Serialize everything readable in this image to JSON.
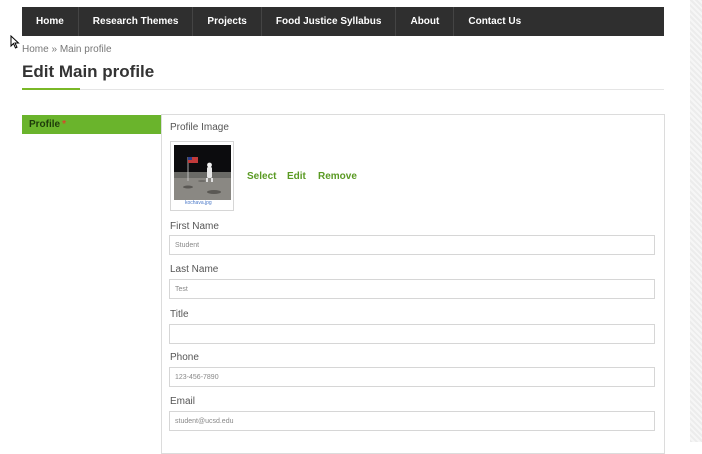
{
  "nav": {
    "items": [
      "Home",
      "Research Themes",
      "Projects",
      "Food Justice Syllabus",
      "About",
      "Contact Us"
    ]
  },
  "breadcrumb": {
    "home": "Home",
    "separator": "»",
    "current": "Main profile"
  },
  "page": {
    "title": "Edit Main profile"
  },
  "tabs": {
    "profile_label": "Profile",
    "required_marker": "*"
  },
  "form": {
    "profile_image_label": "Profile Image",
    "image_filename": "kochava.jpg",
    "image_actions": {
      "select": "Select",
      "edit": "Edit",
      "remove": "Remove"
    },
    "first_name": {
      "label": "First Name",
      "value": "Student"
    },
    "last_name": {
      "label": "Last Name",
      "value": "Test"
    },
    "title_field": {
      "label": "Title",
      "value": ""
    },
    "phone": {
      "label": "Phone",
      "value": "123-456-7890"
    },
    "email": {
      "label": "Email",
      "value": "student@ucsd.edu"
    }
  },
  "colors": {
    "nav_bg": "#2f2f2f",
    "accent_green": "#6ab42c",
    "link_green": "#5a9a23",
    "required_red": "#d9472b"
  }
}
